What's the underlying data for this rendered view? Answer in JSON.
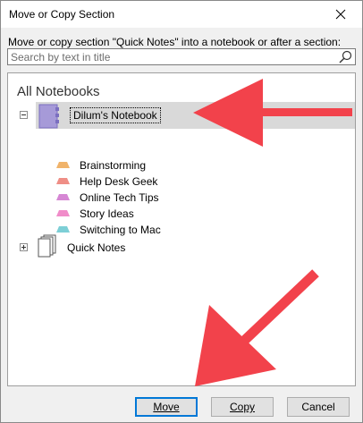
{
  "window": {
    "title": "Move or Copy Section",
    "close_icon": "close-icon"
  },
  "instruction": "Move or copy section \"Quick Notes\" into a notebook or after a section:",
  "search": {
    "placeholder": "Search by text in title",
    "value": "",
    "icon": "search-icon"
  },
  "tree": {
    "header": "All Notebooks",
    "notebook": {
      "label": "Dilum's Notebook",
      "expanded": true,
      "icon_color": "#a69ad8",
      "sections": [
        {
          "label": "Brainstorming",
          "color": "#f0b36a"
        },
        {
          "label": "Help Desk Geek",
          "color": "#ef8e86"
        },
        {
          "label": "Online Tech Tips",
          "color": "#d687d4"
        },
        {
          "label": "Story Ideas",
          "color": "#f08cc9"
        },
        {
          "label": "Switching to Mac",
          "color": "#7dcfd6"
        }
      ]
    },
    "quick_notes": {
      "label": "Quick Notes",
      "expanded": false
    }
  },
  "buttons": {
    "move": "Move",
    "copy": "Copy",
    "cancel": "Cancel"
  },
  "colors": {
    "accent": "#0078d7",
    "annotation_arrow": "#f2424b",
    "selected_row": "#d9d9d9"
  }
}
